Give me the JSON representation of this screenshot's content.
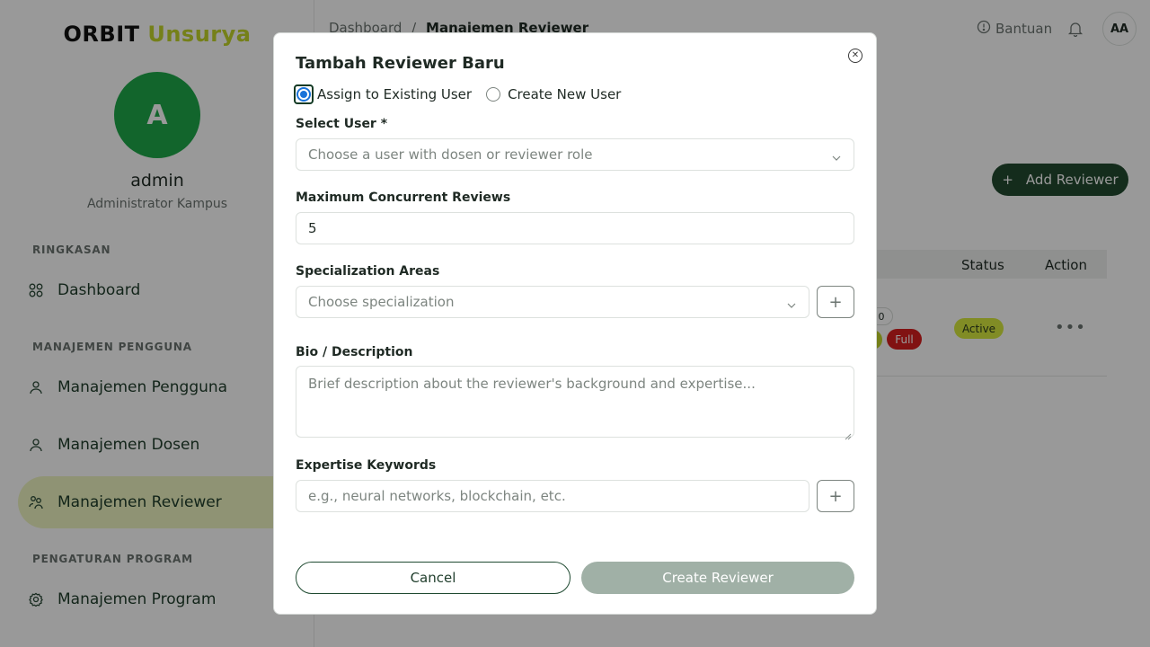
{
  "app": {
    "logo_part1": "ORBIT",
    "logo_part2": "Unsurya"
  },
  "profile": {
    "initial": "A",
    "name": "admin",
    "role": "Administrator Kampus"
  },
  "sidebar": {
    "sections": [
      {
        "title": "RINGKASAN"
      },
      {
        "title": "MANAJEMEN PENGGUNA"
      },
      {
        "title": "PENGATURAN PROGRAM"
      }
    ],
    "items": [
      {
        "label": "Dashboard",
        "icon": "grid-icon"
      },
      {
        "label": "Manajemen Pengguna",
        "icon": "user-icon"
      },
      {
        "label": "Manajemen Dosen",
        "icon": "user-icon"
      },
      {
        "label": "Manajemen Reviewer",
        "icon": "users-icon",
        "active": true
      },
      {
        "label": "Manajemen Program",
        "icon": "settings-icon"
      }
    ]
  },
  "header": {
    "breadcrumb_root": "Dashboard",
    "breadcrumb_sep": "/",
    "breadcrumb_current": "Manajemen Reviewer",
    "help_label": "Bantuan",
    "user_initials": "AA"
  },
  "page": {
    "add_button": "Add Reviewer",
    "table": {
      "columns": [
        "Status",
        "Action"
      ],
      "row": {
        "load_count": "0",
        "load_badge": "Full",
        "status": "Active",
        "action": "•••"
      }
    }
  },
  "modal": {
    "title": "Tambah Reviewer Baru",
    "radio_existing": "Assign to Existing User",
    "radio_new": "Create New User",
    "select_user_label": "Select User *",
    "select_user_placeholder": "Choose a user with dosen or reviewer role",
    "max_reviews_label": "Maximum Concurrent Reviews",
    "max_reviews_value": "5",
    "specialization_label": "Specialization Areas",
    "specialization_placeholder": "Choose specialization",
    "bio_label": "Bio / Description",
    "bio_placeholder": "Brief description about the reviewer's background and expertise...",
    "keywords_label": "Expertise Keywords",
    "keywords_placeholder": "e.g., neural networks, blockchain, etc.",
    "cancel_label": "Cancel",
    "create_label": "Create Reviewer"
  },
  "colors": {
    "brand_green": "#224a30",
    "accent_lime": "#c3d62b",
    "avatar_green": "#1ea84a",
    "danger": "#d81f1f"
  }
}
